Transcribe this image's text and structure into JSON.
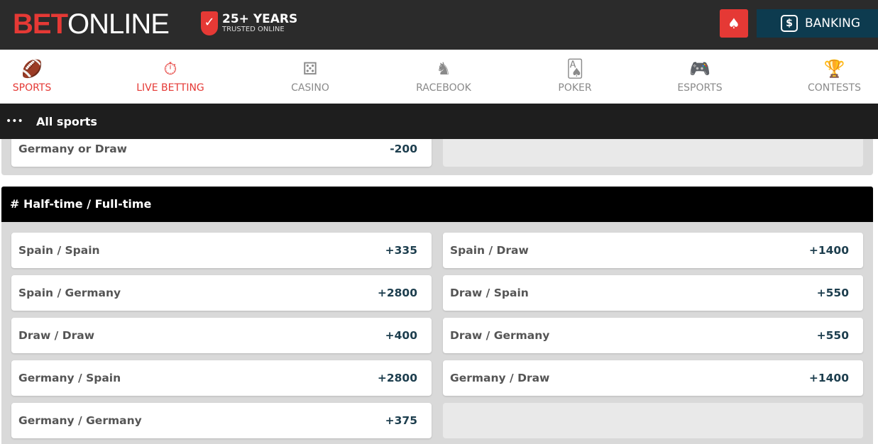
{
  "header": {
    "logo_bet": "BET",
    "logo_online": "ONLINE",
    "trust_title": "25+ YEARS",
    "trust_sub": "TRUSTED ONLINE",
    "poker_icon": "spade-21-icon",
    "banking_label": "BANKING"
  },
  "nav": [
    {
      "label": "SPORTS",
      "icon": "sports-ball-icon",
      "active": true
    },
    {
      "label": "LIVE BETTING",
      "icon": "stopwatch-icon",
      "active": true
    },
    {
      "label": "CASINO",
      "icon": "dice-icon"
    },
    {
      "label": "RACEBOOK",
      "icon": "horse-icon"
    },
    {
      "label": "POKER",
      "icon": "cards-icon"
    },
    {
      "label": "ESPORTS",
      "icon": "gamepad-icon"
    },
    {
      "label": "CONTESTS",
      "icon": "trophy-icon"
    }
  ],
  "subnav": {
    "menu_icon": "ellipsis-icon",
    "label": "All sports"
  },
  "prev_market": {
    "options": [
      {
        "name": "Germany or Draw",
        "odds": "-200"
      }
    ]
  },
  "market": {
    "title": "# Half-time / Full-time",
    "options": [
      {
        "name": "Spain / Spain",
        "odds": "+335"
      },
      {
        "name": "Spain / Draw",
        "odds": "+1400"
      },
      {
        "name": "Spain / Germany",
        "odds": "+2800"
      },
      {
        "name": "Draw / Spain",
        "odds": "+550"
      },
      {
        "name": "Draw / Draw",
        "odds": "+400"
      },
      {
        "name": "Draw / Germany",
        "odds": "+550"
      },
      {
        "name": "Germany / Spain",
        "odds": "+2800"
      },
      {
        "name": "Germany / Draw",
        "odds": "+1400"
      },
      {
        "name": "Germany / Germany",
        "odds": "+375"
      }
    ]
  },
  "colors": {
    "brand_red": "#e53935",
    "banking_bg": "#0d3b4f",
    "odds": "#1d3e4e"
  }
}
